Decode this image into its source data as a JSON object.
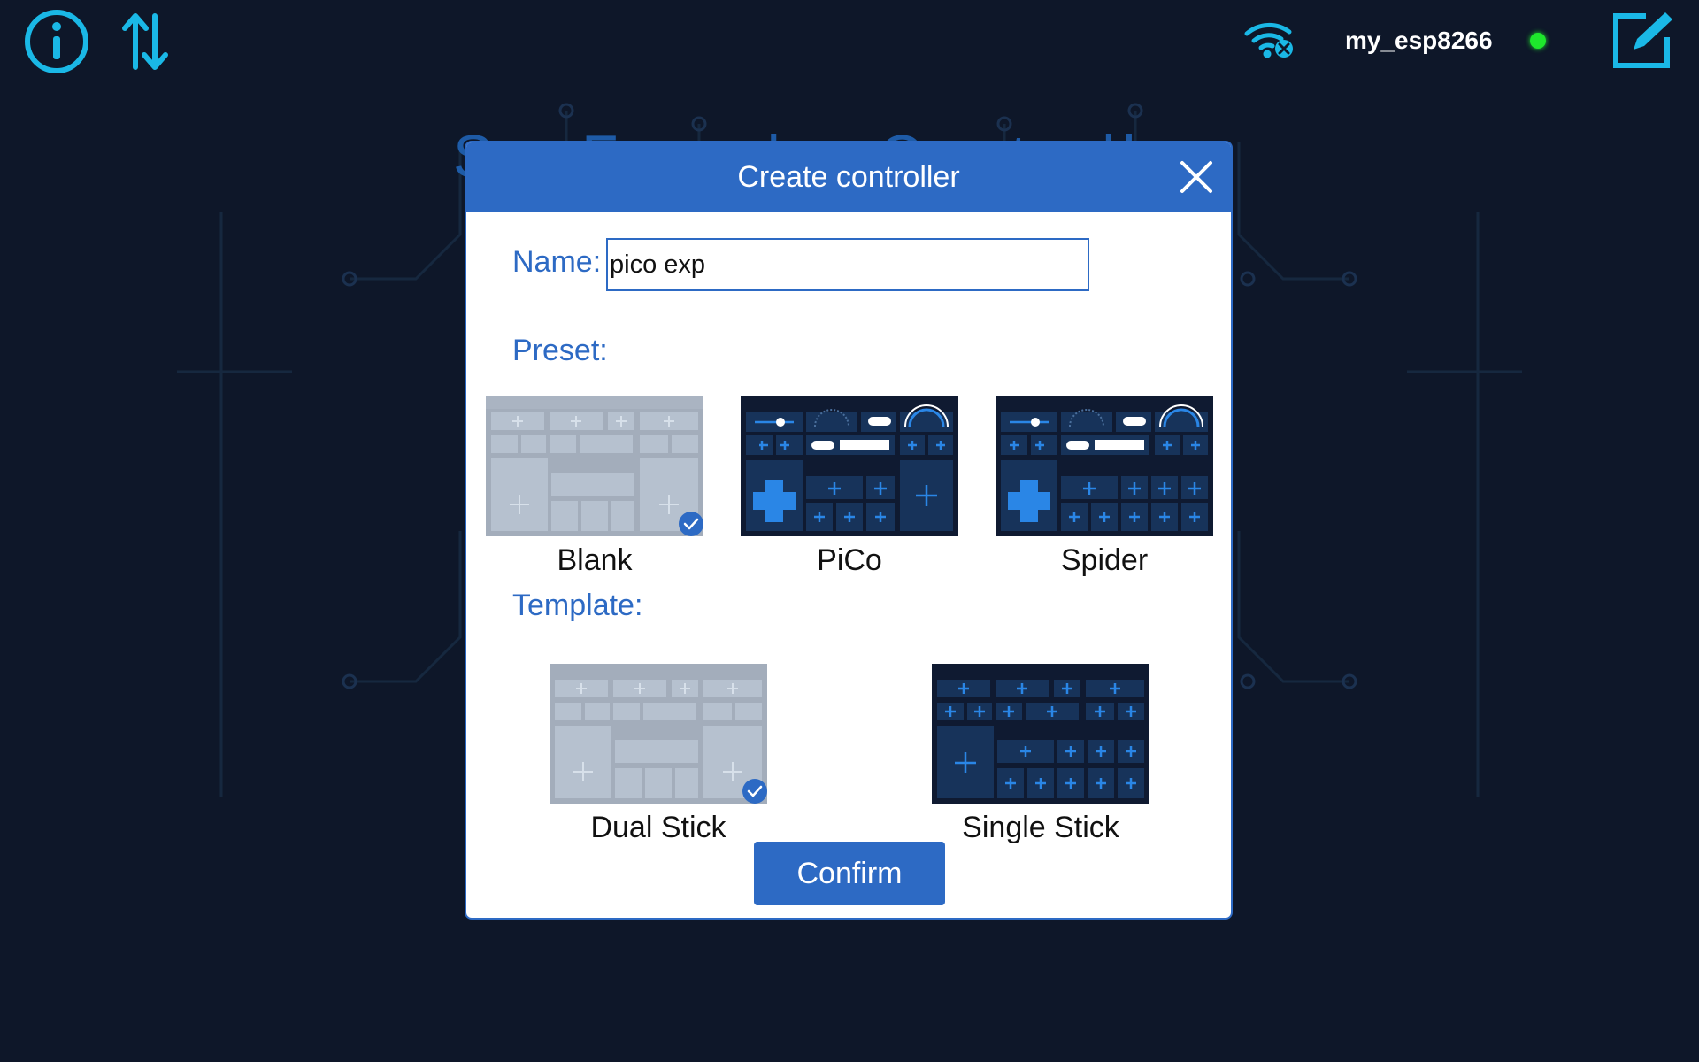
{
  "topbar": {
    "info_icon": "info-icon",
    "sort_icon": "sort-arrows-icon",
    "wifi_icon": "wifi-disconnected-icon",
    "device_name": "my_esp8266",
    "status_color": "#1ee82c",
    "edit_icon": "edit-icon"
  },
  "background": {
    "title": "SunFounder Controller"
  },
  "dialog": {
    "title": "Create controller",
    "close_icon": "close-icon",
    "name_label": "Name:",
    "name_value": "pico exp",
    "preset_label": "Preset:",
    "presets": [
      {
        "label": "Blank",
        "style": "blank",
        "selected": true
      },
      {
        "label": "PiCo",
        "style": "pico",
        "selected": false
      },
      {
        "label": "Spider",
        "style": "spider",
        "selected": false
      }
    ],
    "template_label": "Template:",
    "templates": [
      {
        "label": "Dual Stick",
        "style": "dual",
        "selected": true
      },
      {
        "label": "Single Stick",
        "style": "single",
        "selected": false
      }
    ],
    "confirm_label": "Confirm"
  },
  "colors": {
    "background": "#0e1729",
    "accent": "#2d6ac4",
    "cyan_icon": "#1ab8e6",
    "status_online": "#1ee82c"
  }
}
